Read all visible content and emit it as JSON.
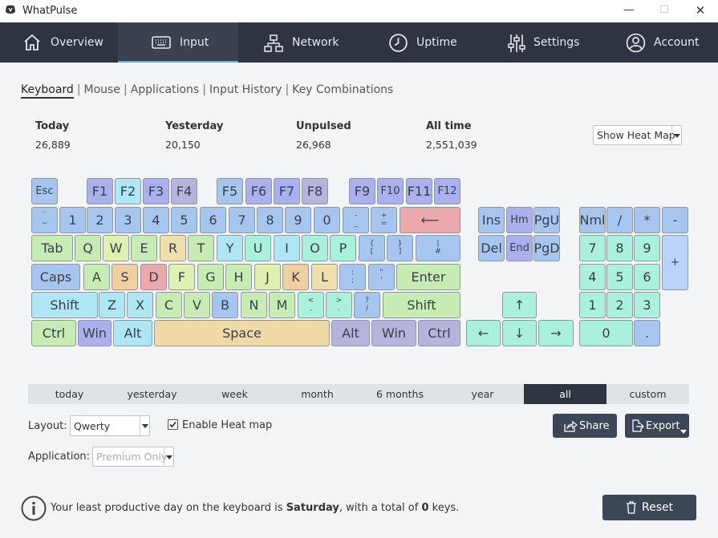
{
  "window": {
    "title": "WhatPulse",
    "minimize": "—",
    "maximize": "☐",
    "close": "✕"
  },
  "nav": {
    "tabs": [
      {
        "label": "Overview",
        "icon": "home-icon"
      },
      {
        "label": "Input",
        "icon": "keyboard-icon",
        "active": true
      },
      {
        "label": "Network",
        "icon": "network-icon"
      },
      {
        "label": "Uptime",
        "icon": "clock-icon"
      },
      {
        "label": "Settings",
        "icon": "sliders-icon"
      },
      {
        "label": "Account",
        "icon": "user-icon"
      }
    ]
  },
  "subnav": {
    "items": [
      "Keyboard",
      "Mouse",
      "Applications",
      "Input History",
      "Key Combinations"
    ],
    "separator": "|"
  },
  "stats": [
    {
      "label": "Today",
      "value": "26,889"
    },
    {
      "label": "Yesterday",
      "value": "20,150"
    },
    {
      "label": "Unpulsed",
      "value": "26,968"
    },
    {
      "label": "All time",
      "value": "2,551,039"
    }
  ],
  "heatmap_select": {
    "value": "Show Heat Map"
  },
  "keyboard": {
    "keys": {
      "esc": "Esc",
      "f1": "F1",
      "f2": "F2",
      "f3": "F3",
      "f4": "F4",
      "f5": "F5",
      "f6": "F6",
      "f7": "F7",
      "f8": "F8",
      "f9": "F9",
      "f10": "F10",
      "f11": "F11",
      "f12": "F12",
      "backtick_top": "`",
      "backtick_bot": "~",
      "n1": "1",
      "n2": "2",
      "n3": "3",
      "n4": "4",
      "n5": "5",
      "n6": "6",
      "n7": "7",
      "n8": "8",
      "n9": "9",
      "n0": "0",
      "minus_top": "-",
      "minus_bot": "_",
      "equal_top": "+",
      "equal_bot": "=",
      "backspace": "⟵",
      "tab": "Tab",
      "q": "Q",
      "w": "W",
      "e": "E",
      "r": "R",
      "t": "T",
      "y": "Y",
      "u": "U",
      "i": "I",
      "o": "O",
      "p": "P",
      "lbracket_top": "{",
      "lbracket_bot": "[",
      "rbracket_top": "}",
      "rbracket_bot": "]",
      "backslash_top": "|",
      "backslash_bot": "#",
      "caps": "Caps",
      "a": "A",
      "s": "S",
      "d": "D",
      "f": "F",
      "g": "G",
      "h": "H",
      "j": "J",
      "k": "K",
      "l": "L",
      "semicolon_top": ":",
      "semicolon_bot": ";",
      "quote_top": "\"",
      "quote_bot": "'",
      "enter": "Enter",
      "lshift": "Shift",
      "z": "Z",
      "x": "X",
      "c": "C",
      "v": "V",
      "b": "B",
      "n": "N",
      "m": "M",
      "comma_top": "<",
      "comma_bot": ",",
      "period_top": ">",
      "period_bot": ".",
      "slash_top": "?",
      "slash_bot": "/",
      "rshift": "Shift",
      "lctrl": "Ctrl",
      "lwin": "Win",
      "lalt": "Alt",
      "space": "Space",
      "ralt": "Alt",
      "rwin": "Win",
      "rctrl": "Ctrl",
      "ins": "Ins",
      "hm": "Hm",
      "pgu": "PgU",
      "del": "Del",
      "end": "End",
      "pgd": "PgD",
      "up": "↑",
      "left": "←",
      "down": "↓",
      "right": "→",
      "nml": "Nml",
      "ndiv": "/",
      "nmul": "*",
      "nsub": "-",
      "n7k": "7",
      "n8k": "8",
      "n9k": "9",
      "nadd": "+",
      "n4k": "4",
      "n5k": "5",
      "n6k": "6",
      "n1k": "1",
      "n2k": "2",
      "n3k": "3",
      "n0k": "0",
      "ndot": "."
    }
  },
  "periods": {
    "items": [
      "today",
      "yesterday",
      "week",
      "month",
      "6 months",
      "year",
      "all",
      "custom"
    ],
    "active": "all"
  },
  "controls": {
    "layout_label": "Layout:",
    "layout_value": "Qwerty",
    "heatmap_checkbox_label": "Enable Heat map",
    "heatmap_checked": true,
    "application_label": "Application:",
    "application_placeholder": "Premium Only",
    "share_label": "Share",
    "export_label": "Export"
  },
  "footer": {
    "text_prefix": "Your least productive day on the keyboard is ",
    "day": "Saturday",
    "text_middle": ", with a total of ",
    "count": "0",
    "text_suffix": " keys.",
    "reset_label": "Reset"
  }
}
